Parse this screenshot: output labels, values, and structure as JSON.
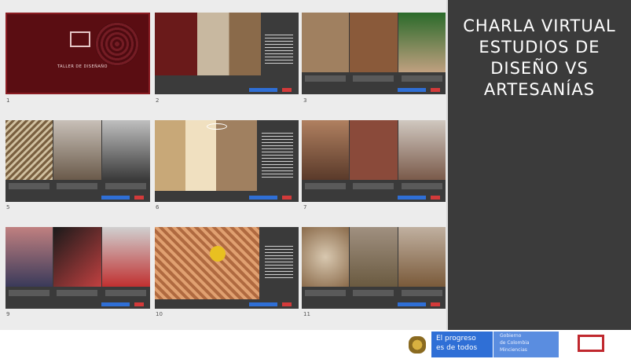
{
  "sidebar": {
    "title": "CHARLA VIRTUAL\nESTUDIOS DE\nDISEÑO VS\nARTESANÍAS"
  },
  "slides": [
    {
      "num": "1"
    },
    {
      "num": "2"
    },
    {
      "num": "3"
    },
    {
      "num": "5"
    },
    {
      "num": "6"
    },
    {
      "num": "7"
    },
    {
      "num": "9"
    },
    {
      "num": "10"
    },
    {
      "num": "11"
    }
  ],
  "cover": {
    "heading": "TALLER DE DISEÑAÑO"
  },
  "footer": {
    "progress_line1": "El progreso",
    "progress_line2": "es de todos",
    "ministry_line1": "Gobierno",
    "ministry_line2": "de Colombia",
    "ministry_line3": "Minciencias"
  },
  "colors": {
    "accent_blue": "#2f6fd6",
    "accent_red": "#d33a3a",
    "cover_red": "#6b1015"
  }
}
